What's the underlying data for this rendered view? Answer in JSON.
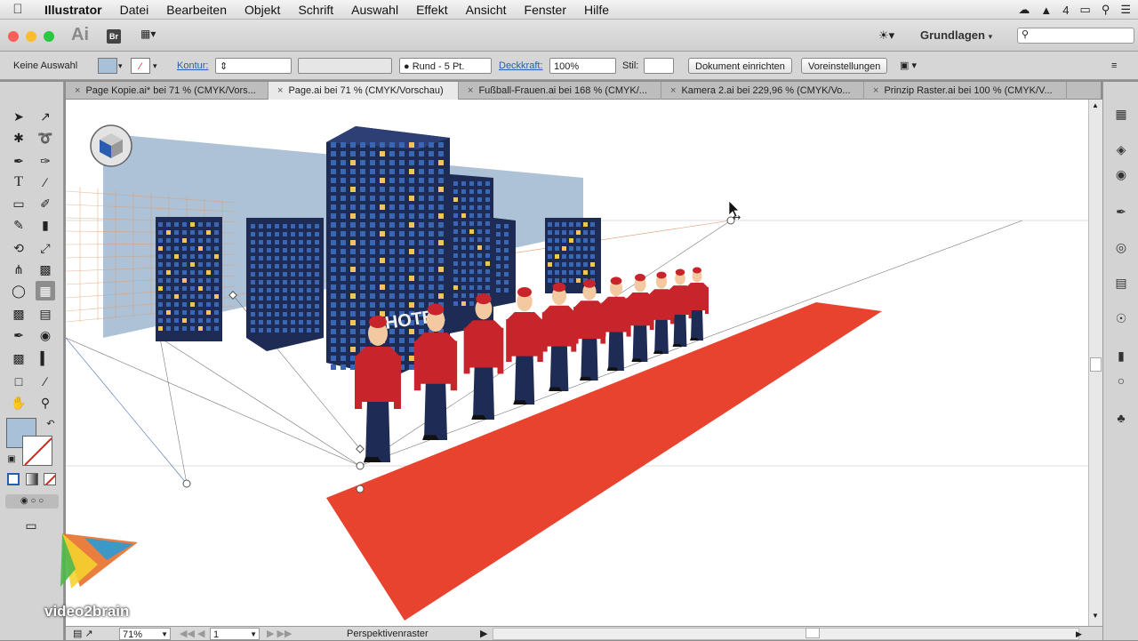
{
  "menubar": {
    "apple": "",
    "items": [
      "Illustrator",
      "Datei",
      "Bearbeiten",
      "Objekt",
      "Schrift",
      "Auswahl",
      "Effekt",
      "Ansicht",
      "Fenster",
      "Hilfe"
    ],
    "status_count": "4"
  },
  "appbar": {
    "logo": "Ai",
    "bridge": "Br",
    "workspace": "Grundlagen"
  },
  "control": {
    "selection": "Keine Auswahl",
    "kontur_label": "Kontur:",
    "stroke_profile": "Rund - 5 Pt.",
    "deckkraft_label": "Deckkraft:",
    "opacity": "100%",
    "stil_label": "Stil:",
    "doc_setup": "Dokument einrichten",
    "prefs": "Voreinstellungen"
  },
  "tabs": [
    "Page Kopie.ai* bei 71 % (CMYK/Vors...",
    "Page.ai bei 71 % (CMYK/Vorschau)",
    "Fußball-Frauen.ai bei 168 % (CMYK/...",
    "Kamera 2.ai bei 229,96 % (CMYK/Vo...",
    "Prinzip Raster.ai bei 100 % (CMYK/V..."
  ],
  "artwork": {
    "hotel_sign": "HOTEL"
  },
  "status": {
    "zoom": "71%",
    "page": "1",
    "tool": "Perspektivenraster"
  },
  "watermark": "video2brain",
  "colors": {
    "carpet": "#e8432f",
    "building": "#1d2b55",
    "window": "#3a67b3",
    "lit_window": "#f2c45a",
    "sky_plane": "#9fb7cf",
    "uniform": "#c8242b"
  }
}
